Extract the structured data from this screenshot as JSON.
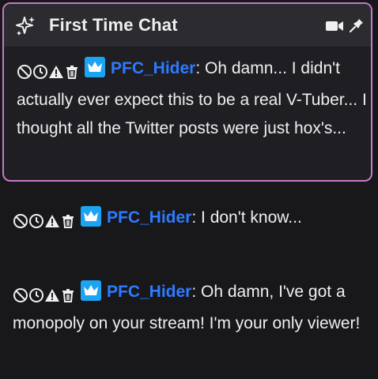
{
  "first_time_chat": {
    "title": "First Time Chat",
    "border_color": "#c678c9",
    "header_icon": "sparkle-icon",
    "actions": [
      "camera-icon",
      "pin-icon"
    ]
  },
  "mod_icons": [
    "ban-icon",
    "timeout-icon",
    "warning-icon",
    "delete-icon"
  ],
  "badge": {
    "name": "crown-icon",
    "color": "#1ca4f3"
  },
  "messages": [
    {
      "username": "PFC_Hider",
      "separator": ": ",
      "text": "Oh damn... I didn't actually ever expect this to be a real V-Tuber... I thought all the Twitter posts were just hox's..."
    },
    {
      "username": "PFC_Hider",
      "separator": ": ",
      "text": "I don't know..."
    },
    {
      "username": "PFC_Hider",
      "separator": ": ",
      "text": "Oh damn, I've got a monopoly on your stream! I'm your only viewer!"
    }
  ],
  "colors": {
    "background": "#18181b",
    "username": "#2e7bff",
    "text": "#efeff1"
  }
}
